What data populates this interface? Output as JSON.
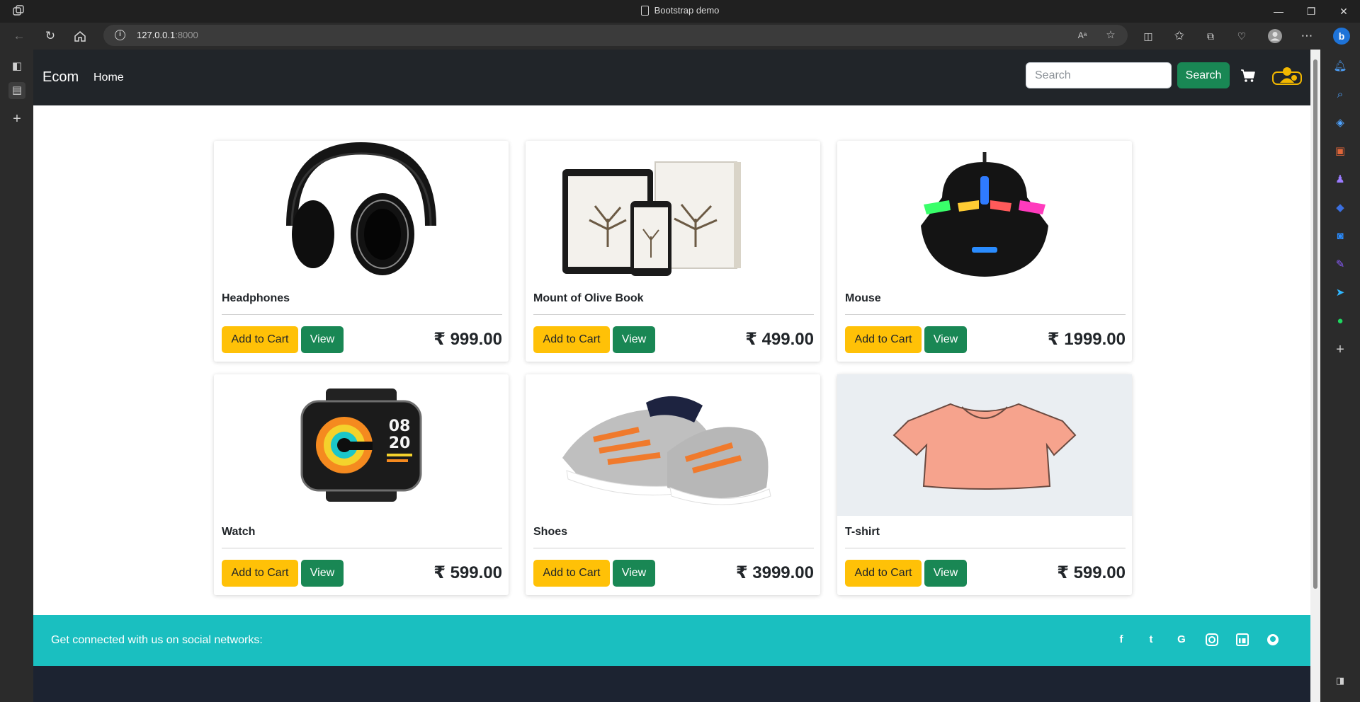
{
  "browser": {
    "tab_title": "Bootstrap demo",
    "url_host": "127.0.0.1",
    "url_port": ":8000",
    "window_buttons": [
      "—",
      "❐",
      "✕"
    ]
  },
  "navbar": {
    "brand": "Ecom",
    "links": [
      "Home"
    ],
    "search_placeholder": "Search",
    "search_button": "Search"
  },
  "products": [
    {
      "name": "Headphones",
      "price": "₹ 999.00",
      "add_label": "Add to Cart",
      "view_label": "View",
      "image": "headphones"
    },
    {
      "name": "Mount of Olive Book",
      "price": "₹ 499.00",
      "add_label": "Add to Cart",
      "view_label": "View",
      "image": "book"
    },
    {
      "name": "Mouse",
      "price": "₹ 1999.00",
      "add_label": "Add to Cart",
      "view_label": "View",
      "image": "mouse"
    },
    {
      "name": "Watch",
      "price": "₹ 599.00",
      "add_label": "Add to Cart",
      "view_label": "View",
      "image": "watch"
    },
    {
      "name": "Shoes",
      "price": "₹ 3999.00",
      "add_label": "Add to Cart",
      "view_label": "View",
      "image": "shoes"
    },
    {
      "name": "T-shirt",
      "price": "₹ 599.00",
      "add_label": "Add to Cart",
      "view_label": "View",
      "image": "tshirt"
    }
  ],
  "social": {
    "text": "Get connected with us on social networks:",
    "icons": [
      "facebook-icon",
      "twitter-icon",
      "google-icon",
      "instagram-icon",
      "linkedin-icon",
      "github-icon"
    ]
  },
  "colors": {
    "navbar_bg": "#212529",
    "success": "#198754",
    "warning": "#ffc107",
    "social_bg": "#1abfc0",
    "footer_bg": "#1c2331"
  }
}
